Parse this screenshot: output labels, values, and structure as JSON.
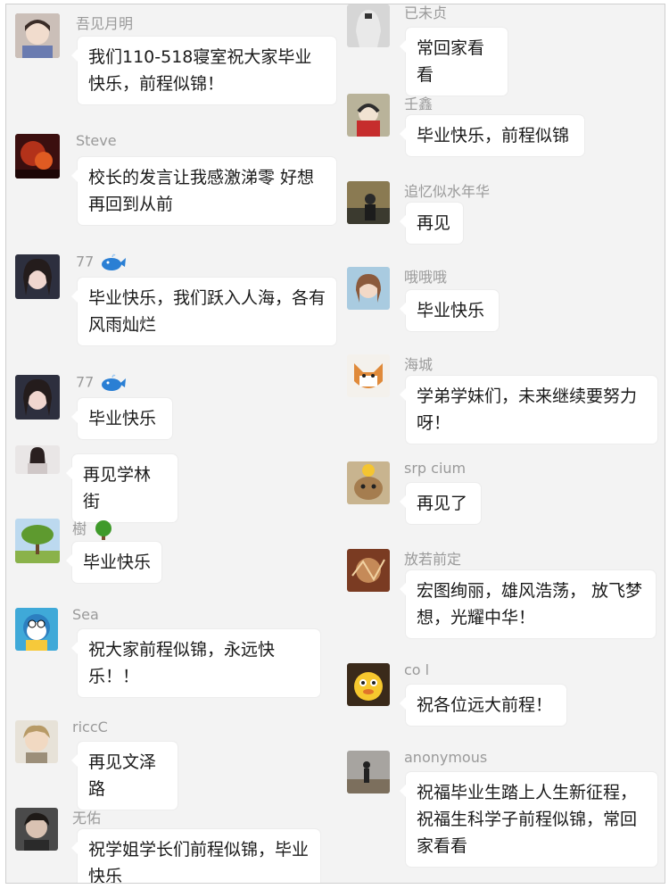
{
  "left_column": [
    {
      "name": "吾见月明",
      "text": "我们110-518寝室祝大家毕业快乐，前程似锦！"
    },
    {
      "name": "Steve",
      "text": "校长的发言让我感激涕零 好想再回到从前"
    },
    {
      "name": "77",
      "emoji": "whale-emoji",
      "text": "毕业快乐，我们跃入人海，各有风雨灿烂"
    },
    {
      "name": "77",
      "emoji": "whale-emoji",
      "text": "毕业快乐"
    },
    {
      "name": "",
      "text": "再见学林街"
    },
    {
      "name": "樹",
      "emoji": "tree-emoji",
      "text": "毕业快乐"
    },
    {
      "name": "Sea",
      "text": "祝大家前程似锦，永远快乐！！"
    },
    {
      "name": "riccC",
      "text": "再见文泽路"
    },
    {
      "name": "无佑",
      "text": "祝学姐学长们前程似锦，毕业快乐"
    }
  ],
  "right_column": [
    {
      "name": "已未贞",
      "text": "常回家看看"
    },
    {
      "name": "壬鑫",
      "text": "毕业快乐，前程似锦"
    },
    {
      "name": "追忆似水年华",
      "text": "再见"
    },
    {
      "name": "哦哦哦",
      "text": "毕业快乐"
    },
    {
      "name": "海城",
      "text": "学弟学妹们，未来继续要努力呀！"
    },
    {
      "name": "srp cium",
      "text": "再见了"
    },
    {
      "name": "放若前定",
      "text": "宏图绚丽，雄风浩荡， 放飞梦想，光耀中华！"
    },
    {
      "name": "co l",
      "text": "祝各位远大前程！"
    },
    {
      "name": "anonymous",
      "text": "祝福毕业生踏上人生新征程，祝福生科学子前程似锦，常回家看看"
    }
  ],
  "colors": {
    "background": "#f3f3f3",
    "bubble": "#ffffff",
    "name_text": "#9a9a9a",
    "message_text": "#1a1a1a"
  }
}
